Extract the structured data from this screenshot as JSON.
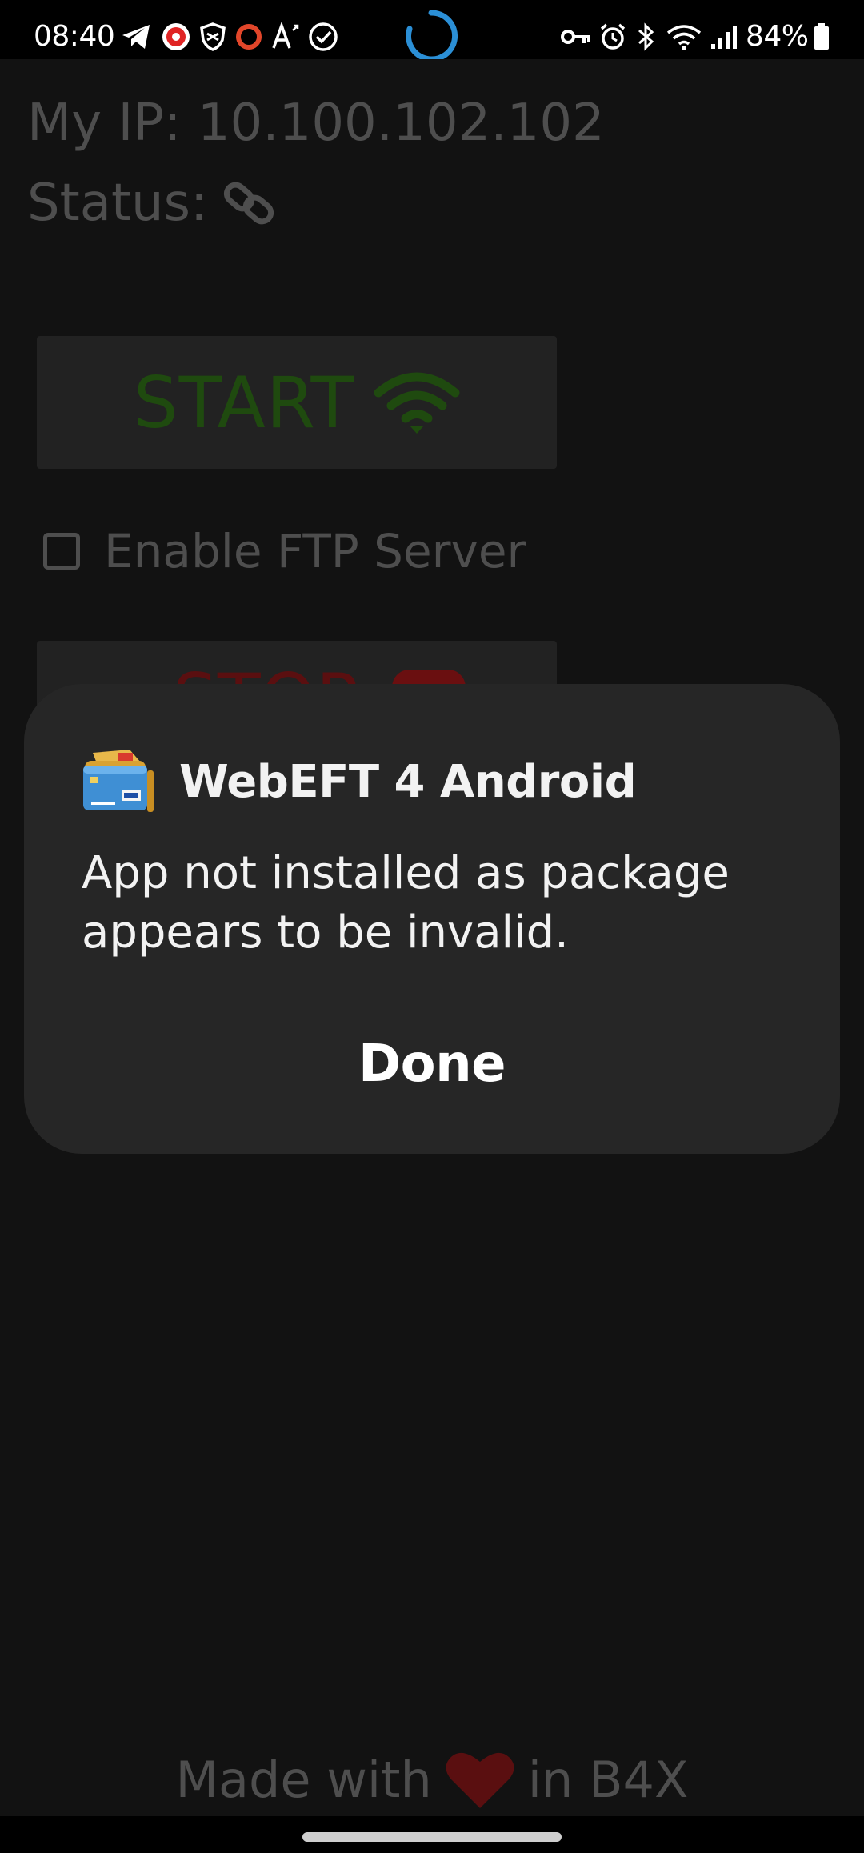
{
  "status_bar": {
    "time": "08:40",
    "battery_percent": "84%",
    "left_icons": [
      "telegram-icon",
      "vpn-shield-red-icon",
      "shield-icon",
      "ring-icon",
      "font-size-icon",
      "check-circle-icon"
    ],
    "center_icon": "loading-spinner-icon",
    "right_icons": [
      "key-icon",
      "alarm-icon",
      "bluetooth-icon",
      "wifi-icon",
      "signal-icon",
      "battery-icon"
    ]
  },
  "app": {
    "ip_text": "My IP: 10.100.102.102",
    "status_label": "Status:",
    "status_icon": "link-icon",
    "start_button_label": "START",
    "start_icon": "wifi-icon",
    "ftp_checkbox_label": "Enable FTP Server",
    "ftp_checked": false,
    "stop_button_label": "STOP",
    "footer_prefix": "Made with",
    "footer_suffix": "in B4X",
    "footer_icon": "heart-icon"
  },
  "dialog": {
    "app_icon": "wallet-icon",
    "title": "WebEFT 4 Android",
    "message": "App not installed as package appears to be invalid.",
    "done_label": "Done"
  },
  "colors": {
    "dialog_bg": "#262626",
    "app_bg": "#121212",
    "start_green": "#1f4a0f",
    "stop_red": "#5a0f10",
    "heart_red": "#5a0f10",
    "spinner_blue": "#2b8fd6"
  }
}
